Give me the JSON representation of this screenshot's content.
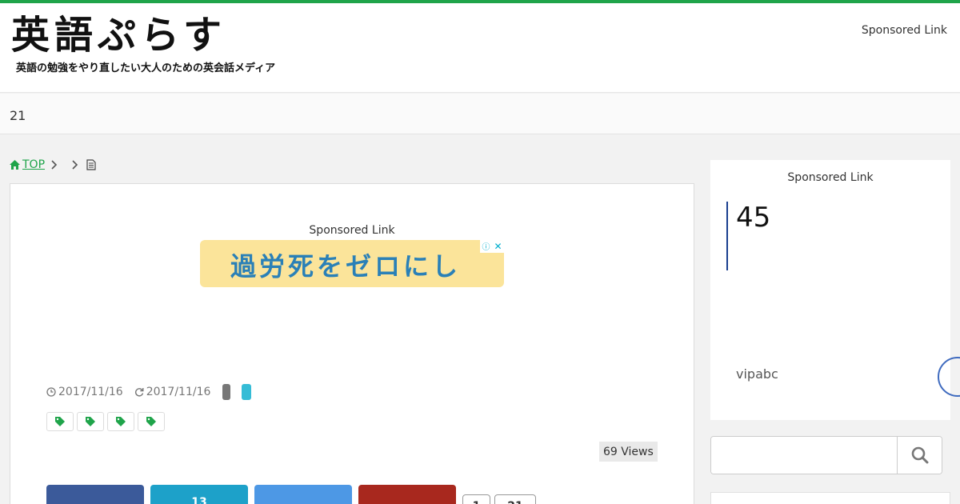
{
  "header": {
    "logo_title": "英語ぷらす",
    "logo_subtitle": "英語の勉強をやり直したい大人のための英会話メディア",
    "sponsored_label": "Sponsored Link"
  },
  "nav": {
    "item": "21"
  },
  "breadcrumb": {
    "home_label": "TOP"
  },
  "main": {
    "ad_label": "Sponsored Link",
    "ad_text": "過労死をゼロにし",
    "ad_info_icon": "ⓘ",
    "ad_close_icon": "✕",
    "published": "2017/11/16",
    "updated": "2017/11/16",
    "views": "69 Views",
    "share": {
      "facebook": "",
      "twitter": "13",
      "googleplus": "",
      "pocket": "",
      "small1": "1",
      "small2": "21"
    }
  },
  "sidebar": {
    "sponsored_label": "Sponsored Link",
    "number": "45",
    "brand": "vipabc",
    "search_placeholder": ""
  },
  "colors": {
    "accent": "#1fa44a",
    "facebook": "#3b5a9a",
    "twitter": "#1da1c9",
    "googleplus": "#4d98e5",
    "pocket": "#a8281e",
    "ad_bg": "#fbe49a",
    "ad_text": "#2a80b7"
  }
}
